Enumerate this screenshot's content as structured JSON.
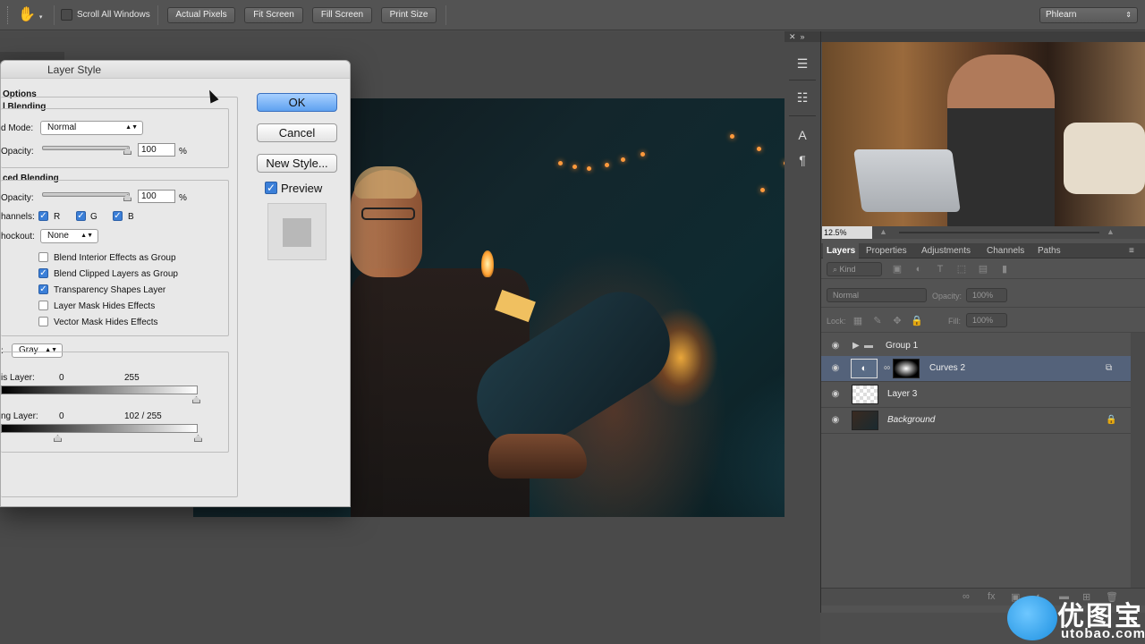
{
  "options_bar": {
    "scroll_all_label": "Scroll All Windows",
    "buttons": [
      "Actual Pixels",
      "Fit Screen",
      "Fill Screen",
      "Print Size"
    ],
    "workspace": "Phlearn"
  },
  "dialog": {
    "title": "Layer Style",
    "options_header": "Options",
    "general_blending": "l Blending",
    "blend_mode_label": "d Mode:",
    "blend_mode_value": "Normal",
    "opacity_label": "Opacity:",
    "opacity_value": "100",
    "percent": "%",
    "advanced_blending": "ced Blending",
    "fill_opacity_label": "Opacity:",
    "fill_opacity_value": "100",
    "channels_label": "hannels:",
    "channel_r": "R",
    "channel_g": "G",
    "channel_b": "B",
    "knockout_label": "hockout:",
    "knockout_value": "None",
    "options": [
      {
        "label": "Blend Interior Effects as Group",
        "checked": false
      },
      {
        "label": "Blend Clipped Layers as Group",
        "checked": true
      },
      {
        "label": "Transparency Shapes Layer",
        "checked": true
      },
      {
        "label": "Layer Mask Hides Effects",
        "checked": false
      },
      {
        "label": "Vector Mask Hides Effects",
        "checked": false
      }
    ],
    "blend_if_label": ":",
    "blend_if_value": "Gray",
    "this_layer_label": "is Layer:",
    "this_layer_min": "0",
    "this_layer_max": "255",
    "underlying_label": "ng Layer:",
    "underlying_min": "0",
    "underlying_split": "102  /  255",
    "ok": "OK",
    "cancel": "Cancel",
    "new_style": "New Style...",
    "preview_label": "Preview"
  },
  "navigator": {
    "zoom": "12.5%"
  },
  "panels": {
    "tabs": [
      "Layers",
      "Properties",
      "Adjustments",
      "Channels",
      "Paths"
    ],
    "kind_label": "Kind",
    "blend_mode": "Normal",
    "opacity_label": "Opacity:",
    "opacity_value": "100%",
    "lock_label": "Lock:",
    "fill_label": "Fill:",
    "fill_value": "100%",
    "layers": [
      {
        "name": "Group 1",
        "type": "group"
      },
      {
        "name": "Curves 2",
        "type": "adjustment",
        "selected": true
      },
      {
        "name": "Layer 3",
        "type": "pixel"
      },
      {
        "name": "Background",
        "type": "background",
        "italic": true
      }
    ]
  },
  "watermark": {
    "chinese": "优图宝",
    "domain": "utobao.com"
  }
}
